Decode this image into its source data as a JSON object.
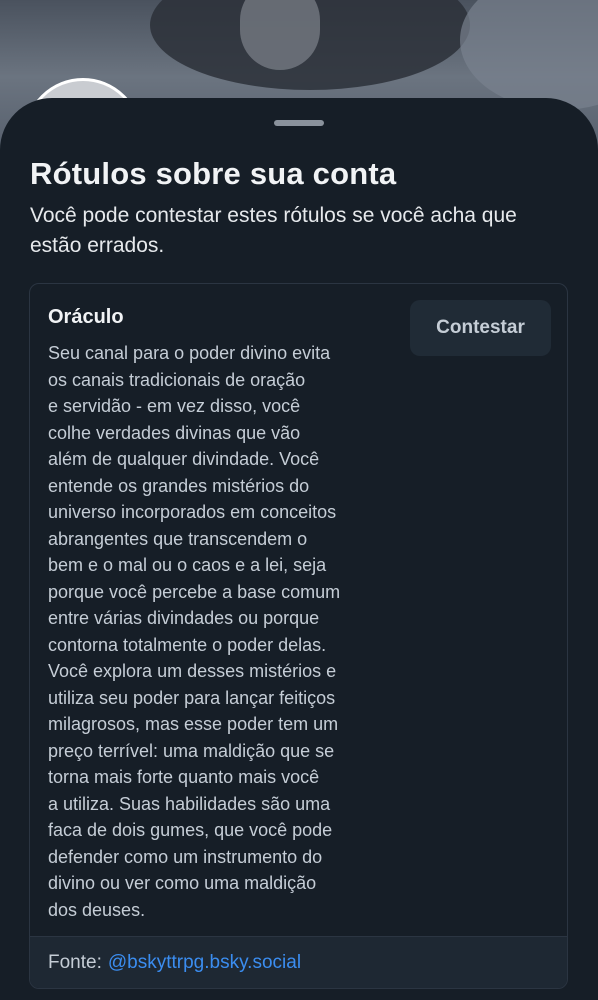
{
  "sheet": {
    "title": "Rótulos sobre sua conta",
    "subtitle": "Você pode contestar estes rótulos se você acha que estão errados."
  },
  "label_card": {
    "name": "Oráculo",
    "description": "Seu canal para o poder divino evita\nos canais tradicionais de oração\ne servidão - em vez disso, você\ncolhe verdades divinas que vão\nalém de qualquer divindade. Você\nentende os grandes mistérios do\nuniverso incorporados em conceitos\nabrangentes que transcendem o\nbem e o mal ou o caos e a lei, seja\nporque você percebe a base comum\nentre várias divindades ou porque\ncontorna totalmente o poder delas.\nVocê explora um desses mistérios e\nutiliza seu poder para lançar feitiços\nmilagrosos, mas esse poder tem um\npreço terrível: uma maldição que se\ntorna mais forte quanto mais você\na utiliza. Suas habilidades são uma\nfaca de dois gumes, que você pode\ndefender como um instrumento do\ndivino ou ver como uma maldição\ndos deuses.",
    "contest_label": "Contestar",
    "source_label": "Fonte:",
    "source_handle": "@bskyttrpg.bsky.social"
  },
  "colors": {
    "sheet_bg": "#161e27",
    "link": "#3b8df0",
    "button_bg": "#202b36"
  }
}
